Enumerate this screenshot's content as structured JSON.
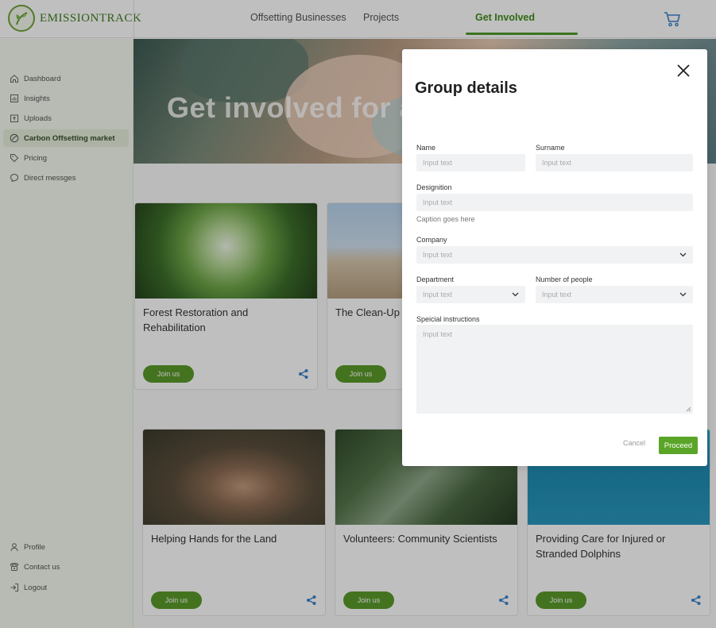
{
  "brand": {
    "name": "EMISSIONTRACK"
  },
  "topnav": {
    "items": [
      "Offsetting Businesses",
      "Projects",
      "Get Involved"
    ],
    "active": "Get Involved"
  },
  "sidebar": {
    "top_items": [
      {
        "label": "Dashboard",
        "icon": "home-icon"
      },
      {
        "label": "Insights",
        "icon": "chart-icon"
      },
      {
        "label": "Uploads",
        "icon": "upload-icon"
      },
      {
        "label": "Carbon Offsetting market",
        "icon": "leaf-icon",
        "active": true
      },
      {
        "label": "Pricing",
        "icon": "tag-icon"
      },
      {
        "label": "Direct messges",
        "icon": "chat-icon"
      }
    ],
    "bottom_items": [
      {
        "label": "Profile",
        "icon": "user-icon"
      },
      {
        "label": "Contact us",
        "icon": "phone-icon"
      },
      {
        "label": "Logout",
        "icon": "logout-icon"
      }
    ]
  },
  "hero": {
    "title": "Get involved for a"
  },
  "cards": [
    {
      "title": "Forest Restoration and Rehabilitation",
      "button": "Join us"
    },
    {
      "title": "The Clean-Up",
      "button": "Join us"
    },
    {
      "title": "Helping Hands for the Land",
      "button": "Join us"
    },
    {
      "title": "Volunteers: Community Scientists",
      "button": "Join us"
    },
    {
      "title": "Providing Care for Injured or Stranded Dolphins",
      "button": "Join us"
    }
  ],
  "modal": {
    "title": "Group details",
    "fields": {
      "name": {
        "label": "Name",
        "placeholder": "Input text"
      },
      "surname": {
        "label": "Surname",
        "placeholder": "Input text"
      },
      "designation": {
        "label": "Designition",
        "placeholder": "Input text",
        "caption": "Caption goes here"
      },
      "company": {
        "label": "Company",
        "placeholder": "Input text"
      },
      "department": {
        "label": "Department",
        "placeholder": "Input text"
      },
      "people": {
        "label": "Number of people",
        "placeholder": "Input text"
      },
      "instructions": {
        "label": "Speicial instructions",
        "placeholder": "Input text"
      }
    },
    "cancel_label": "Cancel",
    "proceed_label": "Proceed"
  },
  "colors": {
    "brand_green": "#5a9a2a",
    "sidebar_bg": "#f4faef",
    "share_blue": "#3a86c8"
  }
}
